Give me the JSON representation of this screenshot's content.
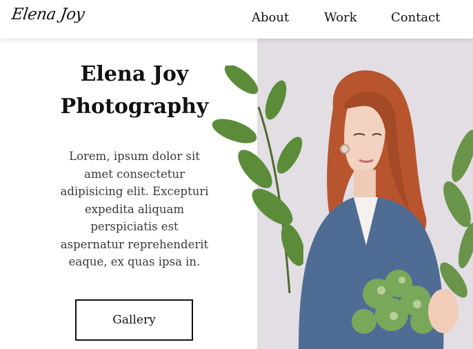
{
  "header": {
    "logo": "Elena Joy",
    "nav": [
      "About",
      "Work",
      "Contact"
    ]
  },
  "hero": {
    "title_line1": "Elena Joy",
    "title_line2": "Photography",
    "lead": "Lorem, ipsum dolor sit amet consectetur adipisicing elit. Excepturi expedita aliquam perspiciatis est aspernatur reprehenderit eaque, ex quas ipsa in.",
    "button_label": "Gallery"
  },
  "colors": {
    "photo_background": "#e2dee3",
    "hair": "#b8552e",
    "sweater": "#4f6c94",
    "leaf": "#5c8c3a"
  }
}
